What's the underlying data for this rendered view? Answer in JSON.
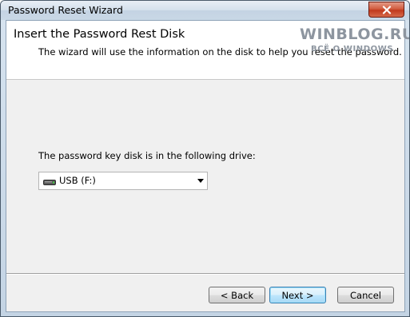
{
  "window": {
    "title": "Password Reset Wizard"
  },
  "header": {
    "title": "Insert the Password Rest Disk",
    "description": "The wizard will use the information on the disk to help you reset the password."
  },
  "watermark": {
    "main": "WINBLOG.RU",
    "sub": "ВСЁ О WINDOWS"
  },
  "body": {
    "drive_label": "The password key disk is in the following drive:",
    "drive_selected": "USB (F:)"
  },
  "buttons": {
    "back": "< Back",
    "next": "Next >",
    "cancel": "Cancel"
  },
  "colors": {
    "close_button": "#c0391c",
    "default_button_border": "#3c7fb1"
  }
}
